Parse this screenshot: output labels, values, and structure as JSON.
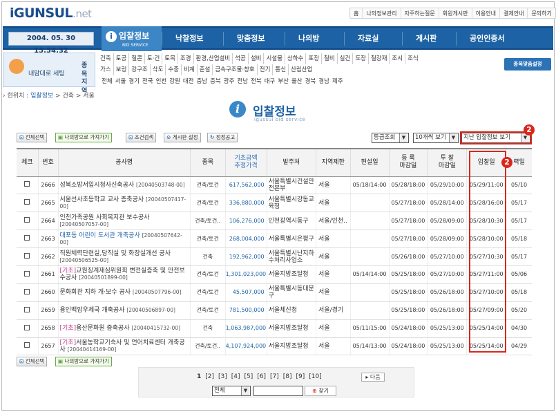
{
  "logo": {
    "main": "iGUNSUL",
    "suffix": ".net"
  },
  "toplinks": [
    "홈",
    "나의정보관리",
    "자주하는질문",
    "회원게시판",
    "이용안내",
    "결제안내",
    "문의하기"
  ],
  "nav": {
    "datetime": "2004. 05. 30  15:54:32",
    "active": {
      "label": "입찰정보",
      "sub": "BID SERVICE",
      "icon": "info-icon"
    },
    "items": [
      "낙찰정보",
      "맞춤정보",
      "나의방",
      "자료실",
      "게시판",
      "공인인증서"
    ]
  },
  "side": {
    "label": "내맘대로 세팅",
    "jong": "종 목",
    "jiyeok": "지 역"
  },
  "categories": {
    "row1": [
      "건축",
      "토공",
      "철콘",
      "토·건",
      "토목",
      "조경",
      "환경,산업설비",
      "석공",
      "설비",
      "시설물",
      "상하수",
      "포장",
      "철비",
      "실건",
      "도장",
      "철강재",
      "조시",
      "조식"
    ],
    "row2": [
      "가스",
      "보링",
      "강구조",
      "삭도",
      "수중",
      "비계",
      "준설",
      "금속구조물·창호",
      "전기",
      "통신",
      "산림산업"
    ]
  },
  "regions": [
    "전체",
    "서울",
    "경기",
    "전국",
    "인천",
    "강원",
    "대전",
    "충남",
    "충북",
    "광주",
    "전남",
    "전북",
    "대구",
    "부산",
    "울산",
    "경북",
    "경남",
    "제주"
  ],
  "setting_button": "종목맞춤설정",
  "breadcrumb": {
    "prefix": "› 현위치 : ",
    "current": "입찰정보",
    "rest": " > 건축 > 서울"
  },
  "page_title": {
    "title": "입찰정보",
    "sub": "igussul bid service"
  },
  "toolbar": {
    "select_all": "전체선택",
    "to_mypage": "나의방으로 가져가기",
    "condition_search": "조건검색",
    "board_setting": "게시판 설정",
    "notice": "정정공고"
  },
  "selects": {
    "sort": "등급조회",
    "per_page": "10개씩 보기",
    "past": "지난 입찰정보 보기"
  },
  "badges": {
    "b1": "2",
    "b2": "2"
  },
  "table": {
    "headers": {
      "check": "체크",
      "no": "번호",
      "name": "공사명",
      "type": "종목",
      "price": "기초금액\n추정가격",
      "client": "발주처",
      "region": "지역제한",
      "site": "현설일",
      "reg_deadline": "등 록\n마감일",
      "bid_deadline": "투 찰\n마감일",
      "bid_date": "입찰일",
      "last": "력일"
    },
    "rows": [
      {
        "no": "2666",
        "tag": "",
        "name": "성북소방서입시청사신축공사",
        "code": "[20040503748-00]",
        "type": "건축/토건",
        "price": "617,562,000",
        "client": "서울특별시건설안전본부",
        "region": "서울",
        "site": "05/18/14:00",
        "reg": "05/28/18:00",
        "bid": "05/29/10:00",
        "date": "05/29/11:00",
        "last": "05/10"
      },
      {
        "no": "2665",
        "tag": "",
        "name": "서울선사초등학교 교사 증축공사",
        "code": "[20040507417-00]",
        "type": "건축/토건",
        "price": "336,880,000",
        "client": "서울특별시강동교육청",
        "region": "서울",
        "site": "",
        "reg": "05/27/18:00",
        "bid": "05/28/14:00",
        "date": "05/28/16:00",
        "last": "05/17"
      },
      {
        "no": "2664",
        "tag": "",
        "name": "인천가족공원 사회복지관 보수공사",
        "code": "[20040507057-00]",
        "type": "건축/토건..",
        "price": "106,276,000",
        "client": "인천광역시동구",
        "region": "서울/인천..",
        "site": "",
        "reg": "05/27/18:00",
        "bid": "05/28/09:00",
        "date": "05/28/10:30",
        "last": "05/17"
      },
      {
        "no": "2663",
        "tag": "",
        "name": "대포동 어린이 도서관 개축공사",
        "code": "[20040507642-00]",
        "type": "건축/토건",
        "price": "268,004,000",
        "client": "서울특별시은평구",
        "region": "서울",
        "site": "",
        "reg": "05/27/18:00",
        "bid": "05/28/09:00",
        "date": "05/28/10:00",
        "last": "05/18"
      },
      {
        "no": "2662",
        "tag": "",
        "name": "직원체력단련실,당직실 및 화장실개선 공사",
        "code": "[20040506525-00]",
        "type": "건축",
        "price": "192,962,000",
        "client": "서울특별시난지하수처리사업소",
        "region": "서울",
        "site": "",
        "reg": "05/26/18:00",
        "bid": "05/27/10:00",
        "date": "05/27/10:30",
        "last": "05/17"
      },
      {
        "no": "2661",
        "tag": "[기초]",
        "name": "교원징계재심위원회 변전실증축 및 안전보수공사",
        "code": "[20040501899-00]",
        "type": "건축/토건",
        "price": "1,301,023,000",
        "client": "서울지방조달청",
        "region": "서울",
        "site": "05/14/14:00",
        "reg": "05/25/18:00",
        "bid": "05/27/10:00",
        "date": "05/27/11:00",
        "last": "05/06"
      },
      {
        "no": "2660",
        "tag": "",
        "name": "문화회관 지하 개·보수 공사",
        "code": "[20040507796-00]",
        "type": "건축/토건",
        "price": "45,507,000",
        "client": "서울특별시동대문구",
        "region": "서울",
        "site": "",
        "reg": "05/25/18:00",
        "bid": "05/26/18:00",
        "date": "05/27/10:00",
        "last": "05/18"
      },
      {
        "no": "2659",
        "tag": "",
        "name": "용인백암우체국 개축공사",
        "code": "[20040506897-00]",
        "type": "건축/토건",
        "price": "781,500,000",
        "client": "서울체신청",
        "region": "서울/경기",
        "site": "",
        "reg": "05/25/18:00",
        "bid": "05/26/18:00",
        "date": "05/27/09:00",
        "last": "05/20"
      },
      {
        "no": "2658",
        "tag": "[기초]",
        "name": "용산문화원 증축공사",
        "code": "[20040415732-00]",
        "type": "건축",
        "price": "1,063,987,000",
        "client": "서울지방조달청",
        "region": "서울",
        "site": "05/11/15:00",
        "reg": "05/24/18:00",
        "bid": "05/25/13:00",
        "date": "05/25/14:00",
        "last": "04/30"
      },
      {
        "no": "2657",
        "tag": "[기초]",
        "name": "서울농학교기숙사 및 언어치료센터 개축공사",
        "code": "[20040414169-00]",
        "type": "건축/토건..",
        "price": "4,107,924,000",
        "client": "서울지방조달청",
        "region": "서울",
        "site": "05/14/13:00",
        "reg": "05/24/18:00",
        "bid": "05/25/13:00",
        "date": "05/25/14:00",
        "last": "04/29"
      }
    ]
  },
  "bottom": {
    "select_all": "전체선택",
    "to_mypage": "나의방으로 가져가기"
  },
  "pager": {
    "current": "1",
    "pages": [
      "[2]",
      "[3]",
      "[4]",
      "[5]",
      "[6]",
      "[7]",
      "[8]",
      "[9]",
      "[10]"
    ],
    "next": "다음",
    "search_select": "전체",
    "search_button": "찾기"
  }
}
